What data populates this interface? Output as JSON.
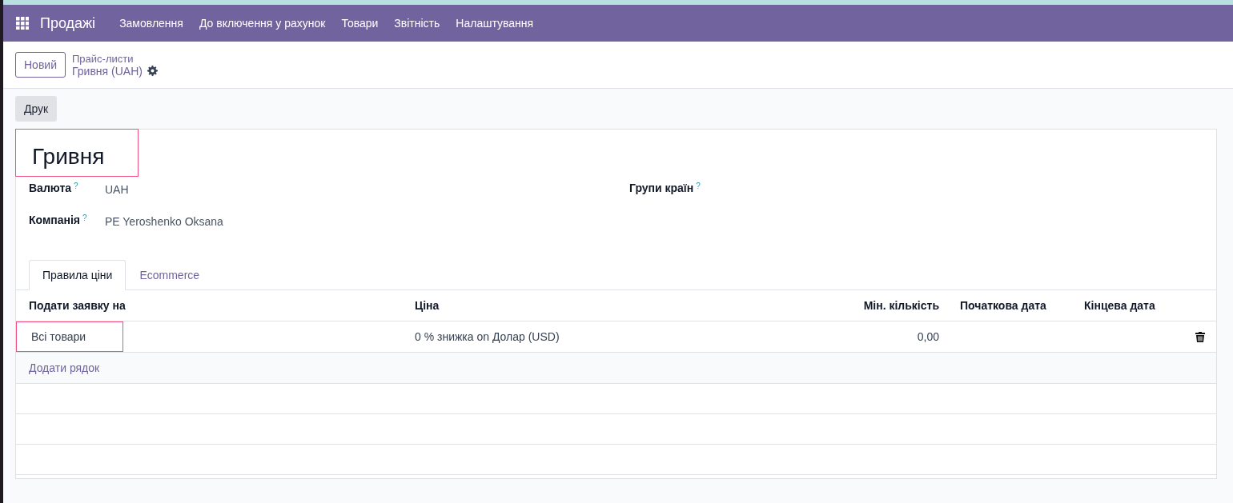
{
  "navbar": {
    "app_name": "Продажі",
    "menu": [
      {
        "label": "Замовлення"
      },
      {
        "label": "До включення у рахунок"
      },
      {
        "label": "Товари"
      },
      {
        "label": "Звітність"
      },
      {
        "label": "Налаштування"
      }
    ]
  },
  "control_panel": {
    "new_button": "Новий",
    "breadcrumb": "Прайс-листи",
    "record_name": "Гривня (UAH)"
  },
  "actions": [
    {
      "label": "Друк"
    }
  ],
  "form": {
    "title": "Гривня",
    "title_highlighted": true,
    "fields_left": [
      {
        "label": "Валюта",
        "help": "?",
        "value": "UAH"
      },
      {
        "label": "Компанія",
        "help": "?",
        "value": "PE Yeroshenko Oksana"
      }
    ],
    "fields_right": [
      {
        "label": "Групи країн",
        "help": "?"
      }
    ],
    "tabs": [
      {
        "label": "Правила ціни",
        "selected": true
      },
      {
        "label": "Ecommerce",
        "selected": false
      }
    ],
    "table": {
      "columns": [
        {
          "label": "Подати заявку на"
        },
        {
          "label": "Ціна"
        },
        {
          "label": "Мін. кількість"
        },
        {
          "label": "Початкова дата"
        },
        {
          "label": "Кінцева дата"
        }
      ],
      "rows": [
        {
          "cells": [
            "Всі товари",
            "0 % знижка on Долар (USD)",
            "0,00",
            "",
            ""
          ],
          "highlighted": true
        }
      ],
      "add_line": "Додати рядок"
    }
  }
}
